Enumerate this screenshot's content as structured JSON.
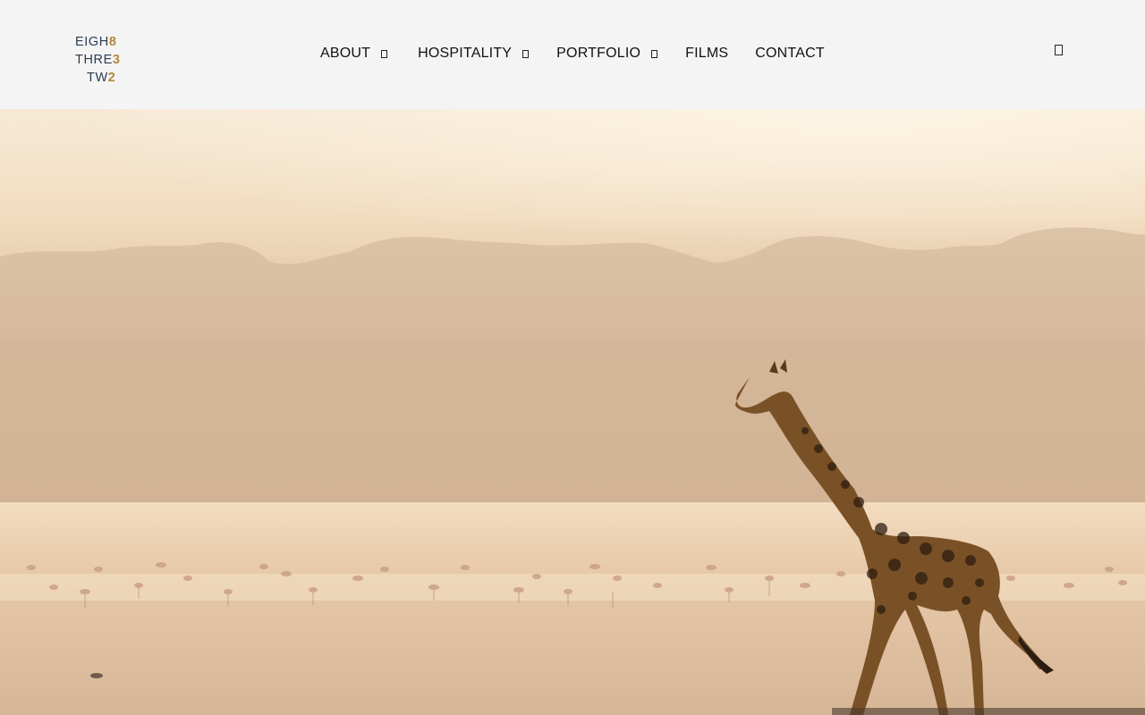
{
  "brand": {
    "logo_lines": [
      {
        "text": "EIGH",
        "digit": "8"
      },
      {
        "text": "THRE",
        "digit": "3"
      },
      {
        "text": "TW",
        "digit": "2"
      }
    ]
  },
  "nav": {
    "about": "ABOUT",
    "hospitality": "HOSPITALITY",
    "portfolio": "PORTFOLIO",
    "films": "FILMS",
    "contact": "CONTACT"
  },
  "icons": {
    "dropdown": "chevron-down-icon",
    "header_action": "search-icon"
  },
  "colors": {
    "header_bg": "#f4f4f5",
    "logo_text": "#2b3d4f",
    "logo_accent": "#b0893a",
    "nav_text": "#111111"
  },
  "hero": {
    "image": "giraffe-walking-at-misty-lake-with-flamingos"
  }
}
